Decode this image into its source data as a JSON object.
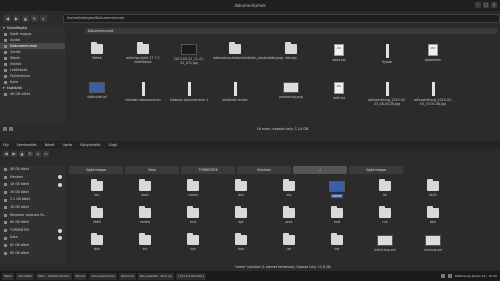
{
  "window": {
    "title": "dokumentumok"
  },
  "toolbar": {
    "path": "/home/kbergier/Dokumentumok"
  },
  "sidebar": {
    "section1": "Számítógép",
    "items1": [
      "Saját mappa",
      "Asztal",
      "Dokumentumok",
      "Zenék",
      "Képek",
      "Videók",
      "Letöltések",
      "Fájlrendszer",
      "Kuka"
    ],
    "section2": "Eszközök",
    "items2": [
      "48 GB kötet"
    ]
  },
  "pane1": {
    "path_tab": "Dokumentumok",
    "row1": [
      "Betek",
      "adlevlgs blaVl 17 1 C beállítások",
      "2013-05-31_11-47-22_471.jpg",
      "adtovaturoutlokszámlátrók_cipsbalbillo.jpeg",
      "denvtg",
      "dena.txt",
      "Sypob",
      "gépetmen"
    ],
    "row2": [
      "Vatikuliet.ixf",
      "hibtalan dokumentum",
      "hibtalan dokumentum 2",
      "okiAmelt rentes",
      "protecting.png",
      "isdlt.txt",
      "adiLavtrthusg_2015-02-03_16-05-08.jpg",
      "adiLavtrthusg_2015-02-03_19-31-08.jpg"
    ],
    "status": "16 elem, szabad hely: 11,8 GB"
  },
  "menubar2": [
    "Fájl",
    "Szerkesztés",
    "Nézet",
    "Ugrás",
    "Könyvjelzők",
    "Súgó"
  ],
  "tabs2": [
    "Saját mappa",
    "Data",
    "TORRENTEK",
    "Munkám",
    "/",
    "Saját mappa"
  ],
  "sidebar2": [
    "48 GB kötet",
    "Mentem",
    "16 GB kötet",
    "16 GB kötet",
    "2.1 GB kötet",
    "16 GB kötet",
    "Rendszer számára fe...",
    "80 GB kötet",
    "TORRENTEK",
    "Data",
    "62 GB kötet",
    "80 GB kötet"
  ],
  "pane2": {
    "row1": [
      "bin",
      "boot",
      "cdrom",
      "dev",
      "etc",
      "home",
      "lib",
      "lib32"
    ],
    "row2": [
      "lib64",
      "media",
      "mnt",
      "opt",
      "proc",
      "root",
      "run",
      "sbin"
    ],
    "row3": [
      "sbin",
      "srv",
      "sys",
      "tmp",
      "usr",
      "var",
      "initrd.img.old",
      "vmlinuz.old"
    ],
    "status": "\"home\" kijelölve (1 elemet tartalmaz), Szabad hely: 11,8 GB"
  },
  "taskbar": {
    "tasks": [
      "Menü",
      "/Munkám",
      "Mihu - Mozilla Firefox",
      "Minion",
      "dokumentumok",
      "Terminál",
      "Könyvjelzők - Xfce (2)",
      "[ [0] 3.0 Monitor]"
    ],
    "clock": "Hétköznap április 15., 16:45"
  },
  "colors": {
    "background": "#2b2b2b",
    "sidebar": "#303030",
    "folder": "#d8d8d8",
    "selected": "#4a4a4a"
  }
}
